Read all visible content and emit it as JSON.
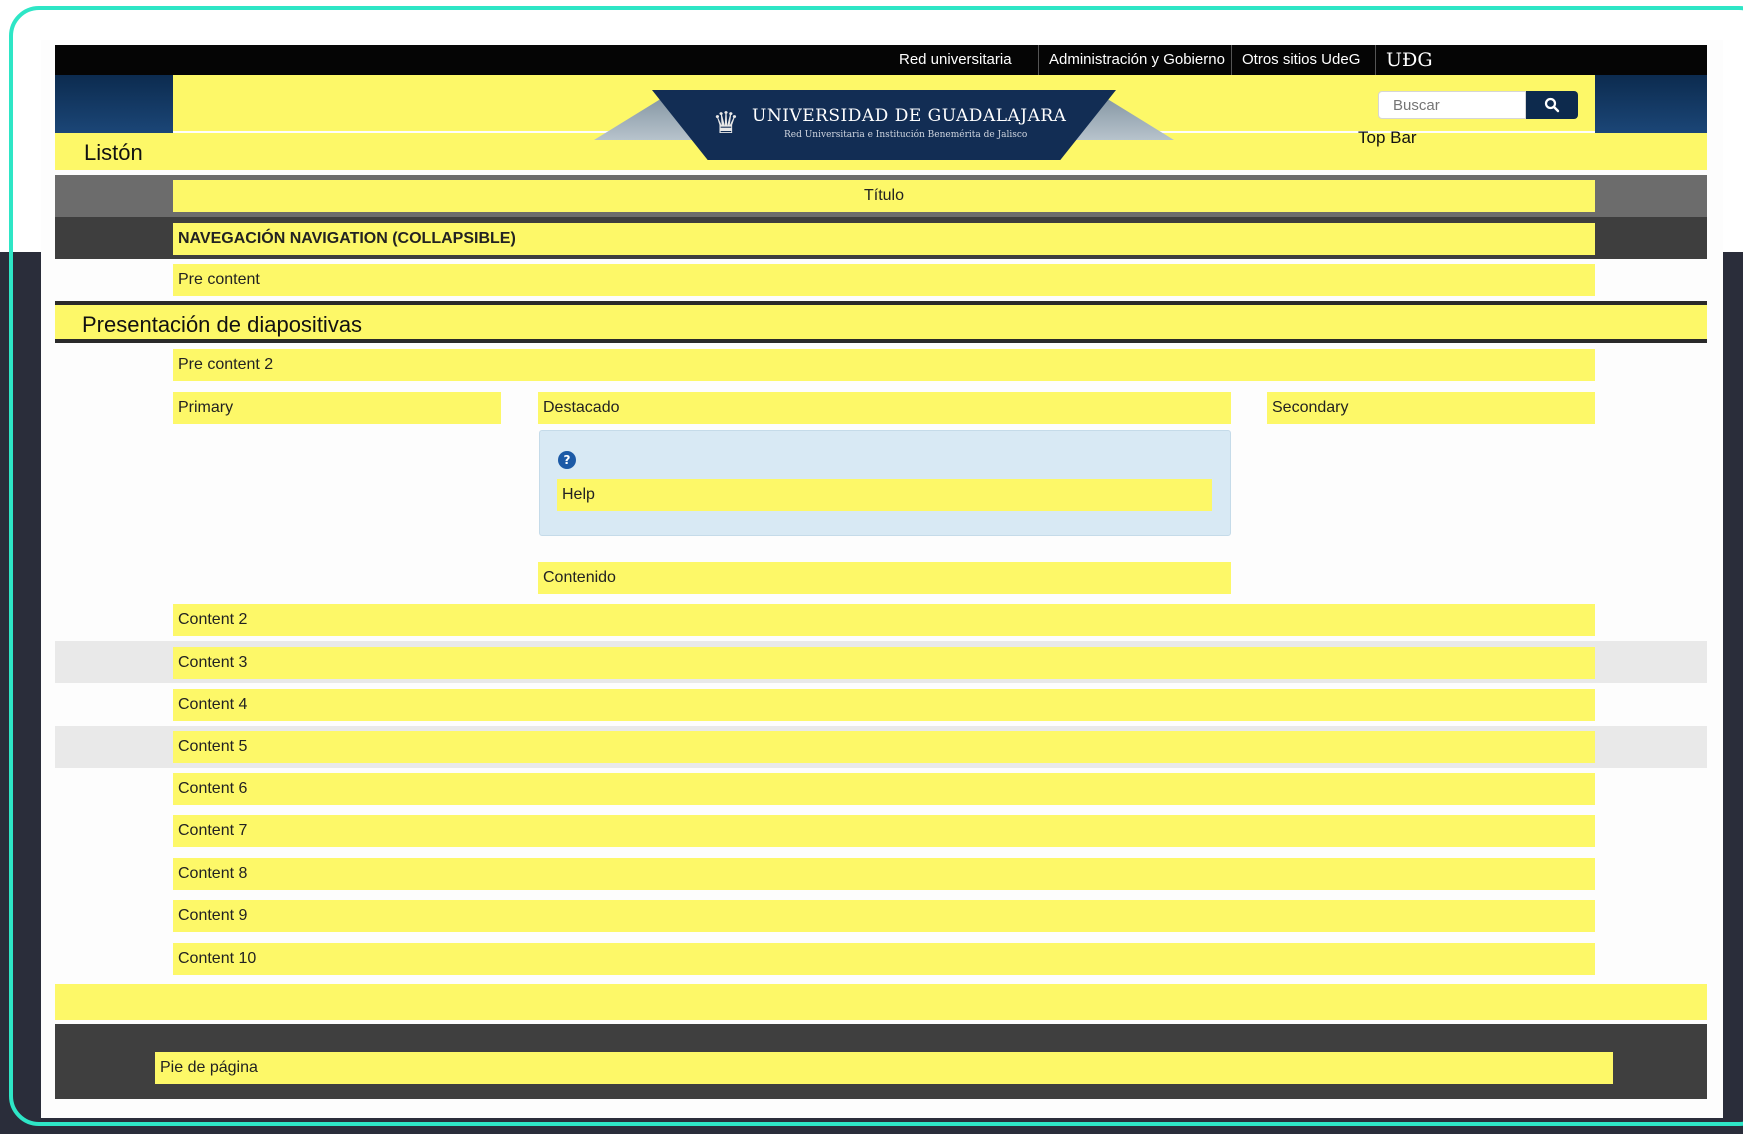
{
  "topbar": {
    "links": [
      "Red universitaria",
      "Administración y Gobierno",
      "Otros sitios UdeG"
    ],
    "brand": "UÐG"
  },
  "header": {
    "logo_title": "UNIVERSIDAD DE GUADALAJARA",
    "logo_subtitle": "Red Universitaria e Institución Benemérita de Jalisco",
    "search_placeholder": "Buscar",
    "top_bar_label": "Top Bar",
    "liston_label": "Listón"
  },
  "regions": {
    "titulo": "Título",
    "navigation": "NAVEGACIÓN NAVIGATION (COLLAPSIBLE)",
    "pre_content": "Pre content",
    "slideshow": "Presentación de diapositivas",
    "pre_content_2": "Pre content 2",
    "primary": "Primary",
    "destacado": "Destacado",
    "secondary": "Secondary",
    "help": "Help",
    "contenido": "Contenido",
    "contents": [
      "Content 2",
      "Content 3",
      "Content 4",
      "Content 5",
      "Content 6",
      "Content 7",
      "Content 8",
      "Content 9",
      "Content 10"
    ],
    "footer": "Pie de página"
  },
  "colors": {
    "accent_yellow": "#fdf868",
    "frame_teal": "#2ee6c6",
    "header_blue": "#0d2a4d"
  }
}
